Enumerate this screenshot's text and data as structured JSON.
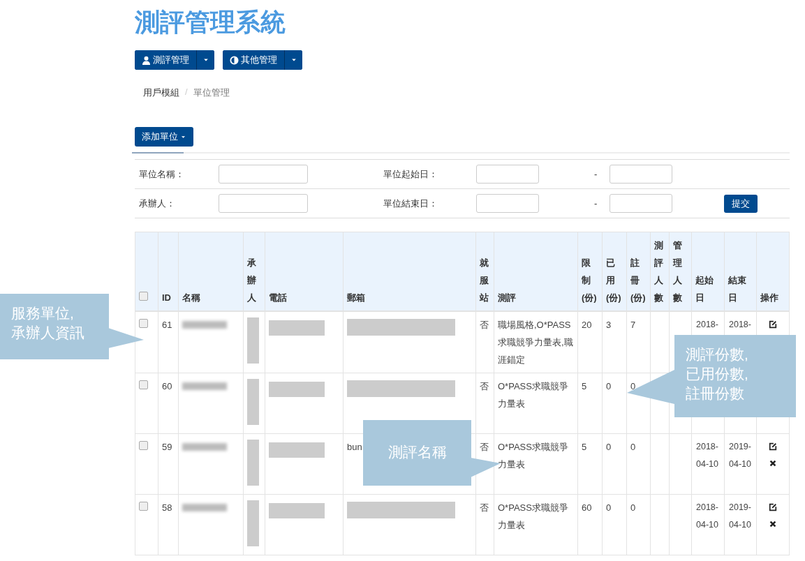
{
  "title": "測評管理系統",
  "menu_buttons": [
    {
      "label": "測評管理"
    },
    {
      "label": "其他管理"
    }
  ],
  "breadcrumb": {
    "separator": "/",
    "items": [
      {
        "label": "用戶模組",
        "current": false
      },
      {
        "label": "單位管理",
        "current": true
      }
    ]
  },
  "add_button": "添加單位",
  "filters": {
    "rows": [
      {
        "name_label": "單位名稱：",
        "date_label": "單位起始日：",
        "range_separator": "-"
      },
      {
        "name_label": "承辦人：",
        "date_label": "單位結束日：",
        "range_separator": "-"
      }
    ],
    "submit": "提交"
  },
  "table": {
    "header_checked": false,
    "columns": [
      "ID",
      "名稱",
      "承辦人",
      "電話",
      "郵箱",
      "就服站",
      "測評",
      "限制(份)",
      "已用(份)",
      "註冊(份)",
      "測評人數",
      "管理人數",
      "起始日",
      "結束日",
      "操作"
    ],
    "rows": [
      {
        "checked": false,
        "id": "61",
        "station": "否",
        "assessment": "職場風格,O*PASS求職競爭力量表,職涯錨定",
        "limit": "20",
        "used": "3",
        "registered": "7",
        "start": "2018-",
        "end": "2018-"
      },
      {
        "checked": false,
        "id": "60",
        "station": "否",
        "assessment": "O*PASS求職競爭力量表",
        "limit": "5",
        "used": "0",
        "registered": "0"
      },
      {
        "checked": false,
        "id": "59",
        "email": "bun",
        "station": "否",
        "assessment": "O*PASS求職競爭力量表",
        "limit": "5",
        "used": "0",
        "registered": "0",
        "start": "2018-04-10",
        "end": "2019-04-10"
      },
      {
        "checked": false,
        "id": "58",
        "station": "否",
        "assessment": "O*PASS求職競爭力量表",
        "limit": "60",
        "used": "0",
        "registered": "0",
        "start": "2018-04-10",
        "end": "2019-04-10"
      }
    ]
  },
  "callouts": [
    {
      "text": "服務單位,\n承辦人資訊"
    },
    {
      "text": "測評份數,\n已用份數,\n註冊份數"
    },
    {
      "text": "測評名稱"
    }
  ]
}
